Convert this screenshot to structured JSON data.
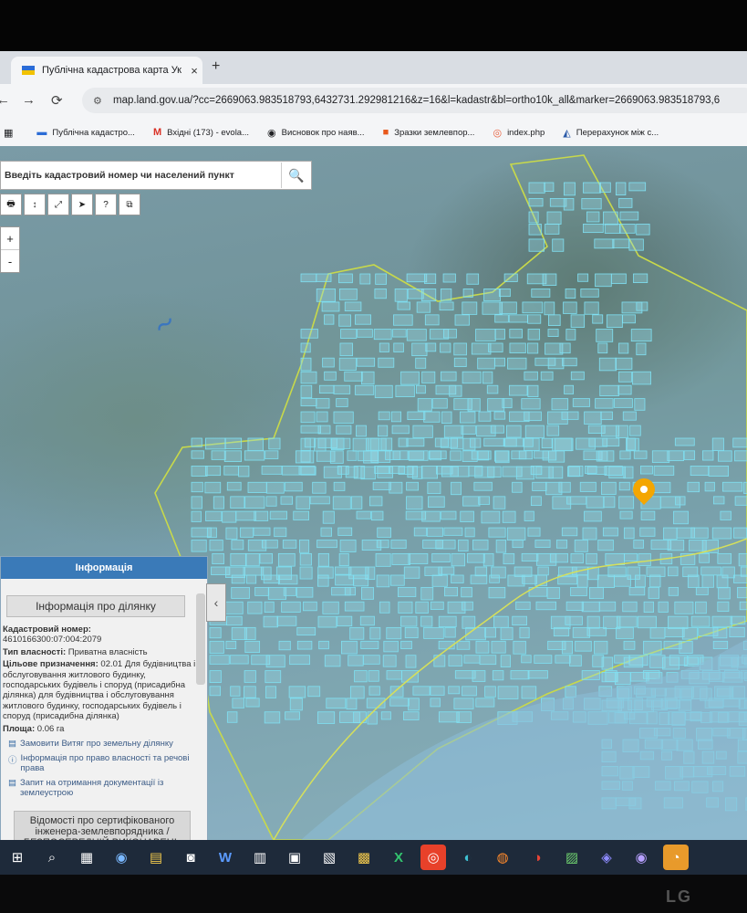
{
  "browser": {
    "tab_title": "Публічна кадастрова карта Ук",
    "tab_close": "×",
    "new_tab": "+",
    "url": "map.land.gov.ua/?cc=2669063.983518793,6432731.292981216&z=16&l=kadastr&bl=ortho10k_all&marker=2669063.983518793,6",
    "back": "←",
    "forward": "→",
    "reload": "⟳",
    "bookmarks": [
      {
        "label": "Публічна кадастро...",
        "icon": "ukraine-flag-icon"
      },
      {
        "label": "Вхідні (173) - evola...",
        "icon": "gmail-icon"
      },
      {
        "label": "Висновок про наяв...",
        "icon": "globe-icon"
      },
      {
        "label": "Зразки землевпор...",
        "icon": "orange-square-icon"
      },
      {
        "label": "index.php",
        "icon": "spiral-icon"
      },
      {
        "label": "Перерахунок між с...",
        "icon": "tool-icon"
      }
    ]
  },
  "map": {
    "search_placeholder": "Введіть кадастровий номер чи населений пункт",
    "search_icon": "🔍",
    "tools": [
      "🖶",
      "↕",
      "⤢",
      "➤",
      "?",
      "⧉"
    ],
    "zoom_in": "+",
    "zoom_out": "-"
  },
  "info_panel": {
    "header": "Інформація",
    "subheader": "Інформація про ділянку",
    "cadastral_label": "Кадастровий номер:",
    "cadastral_value": "4610166300:07:004:2079",
    "ownership_label": "Тип власності:",
    "ownership_value": "Приватна власність",
    "purpose_label": "Цільове призначення:",
    "purpose_value": "02.01 Для будівництва і обслуговування житлового будинку, господарських будівель і споруд (присадибна ділянка) для будівництва і обслуговування житлового будинку, господарських будівель і споруд (присадибна ділянка)",
    "area_label": "Площа:",
    "area_value": "0.06 га",
    "link_extract": "Замовити Витяг про земельну ділянку",
    "link_rights": "Інформація про право власності та речові права",
    "link_docs": "Запит на отримання документації із землеустрою",
    "cert_text": "Відомості про сертифікованого інженера-землевпорядника / БЕЗПОСЕРЕДНІЙ ВИКОНАВЕЦЬ",
    "collapse": "‹"
  },
  "taskbar": {
    "icons": [
      "⊞",
      "⌕",
      "▦",
      "◉",
      "▤",
      "◙",
      "W",
      "▥",
      "▣",
      "▧",
      "▩",
      "X",
      "◎",
      "◐",
      "◍",
      "◑",
      "▨",
      "◈",
      "◉",
      "◔"
    ]
  },
  "monitor": {
    "brand": "LG"
  }
}
